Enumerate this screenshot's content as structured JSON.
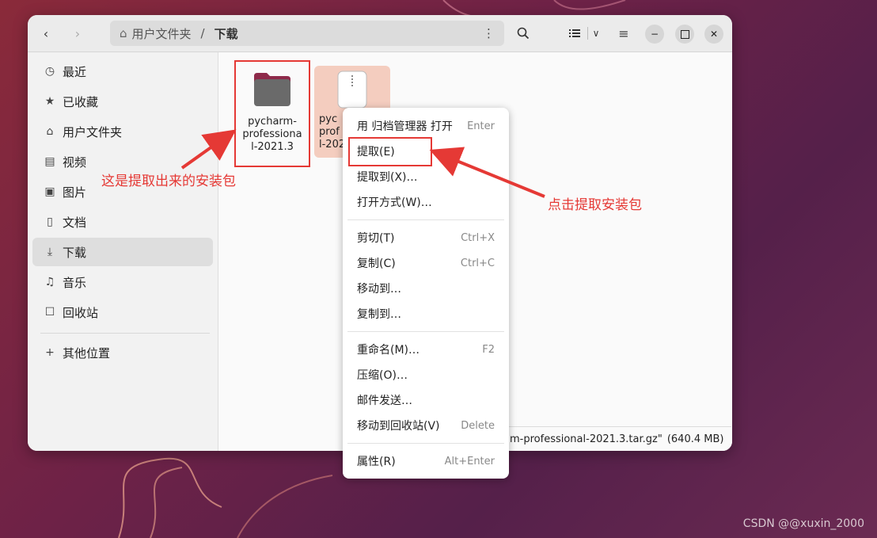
{
  "path": {
    "home": "用户文件夹",
    "separator": "/",
    "current": "下载"
  },
  "sidebar": {
    "items": [
      {
        "icon": "clock-icon",
        "label": "最近"
      },
      {
        "icon": "star-icon",
        "label": "已收藏"
      },
      {
        "icon": "home-icon",
        "label": "用户文件夹"
      },
      {
        "icon": "video-icon",
        "label": "视频"
      },
      {
        "icon": "picture-icon",
        "label": "图片"
      },
      {
        "icon": "document-icon",
        "label": "文档"
      },
      {
        "icon": "download-icon",
        "label": "下载"
      },
      {
        "icon": "music-icon",
        "label": "音乐"
      },
      {
        "icon": "trash-icon",
        "label": "回收站"
      }
    ],
    "other_locations": "其他位置"
  },
  "files": [
    {
      "label": "pycharm-professional-2021.3",
      "icon": "folder-icon"
    },
    {
      "label": "pycharm-professional-2021.3.tar.gz",
      "visible_label": "pycharm-professional-2021.3...",
      "icon": "archive-icon"
    }
  ],
  "file2_lines": [
    "pyc",
    "prof",
    "l-202"
  ],
  "file1_lines": [
    "pycharm-",
    "professiona",
    "l-2021.3"
  ],
  "status": {
    "text": "m-professional-2021.3.tar.gz\"",
    "size": "(640.4 MB)"
  },
  "menu": {
    "items": [
      {
        "label": "用 归档管理器 打开",
        "shortcut": "Enter"
      },
      {
        "label": "提取(E)",
        "shortcut": ""
      },
      {
        "label": "提取到(X)…",
        "shortcut": ""
      },
      {
        "label": "打开方式(W)…",
        "shortcut": ""
      },
      {
        "label": "剪切(T)",
        "shortcut": "Ctrl+X"
      },
      {
        "label": "复制(C)",
        "shortcut": "Ctrl+C"
      },
      {
        "label": "移动到…",
        "shortcut": ""
      },
      {
        "label": "复制到…",
        "shortcut": ""
      },
      {
        "label": "重命名(M)…",
        "shortcut": "F2"
      },
      {
        "label": "压缩(O)…",
        "shortcut": ""
      },
      {
        "label": "邮件发送…",
        "shortcut": ""
      },
      {
        "label": "移动到回收站(V)",
        "shortcut": "Delete"
      },
      {
        "label": "属性(R)",
        "shortcut": "Alt+Enter"
      }
    ]
  },
  "annotations": {
    "left": "这是提取出来的安装包",
    "right": "点击提取安装包"
  },
  "watermark": "CSDN @@xuxin_2000",
  "colors": {
    "accent_red": "#e53935",
    "folder": "#6a6a6a",
    "folder_tab": "#8e2a4a",
    "selected_file_bg": "#f4cdbf"
  }
}
